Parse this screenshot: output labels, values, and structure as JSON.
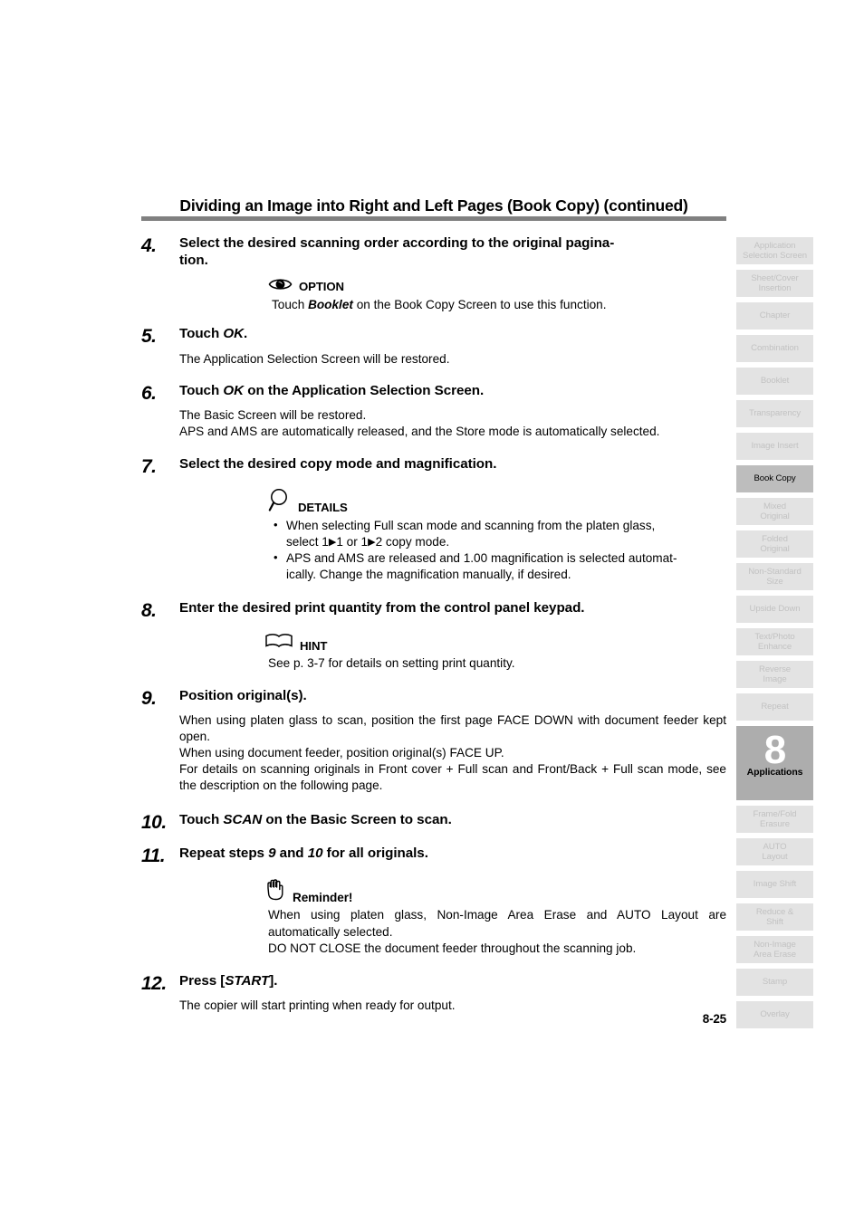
{
  "document": {
    "title": "Dividing an Image into Right and Left Pages (Book Copy) (continued)",
    "page_number": "8-25"
  },
  "steps": [
    {
      "number": "4.",
      "heading": "Select the desired scanning order according to the original pagina-tion.",
      "heading_line1": "Select the desired scanning order according to the original pagina-",
      "heading_line2": "tion."
    },
    {
      "number": "5.",
      "heading_pre": "Touch ",
      "heading_em": "OK",
      "heading_post": ".",
      "body": [
        "The Application Selection Screen will be restored."
      ]
    },
    {
      "number": "6.",
      "heading_pre": "Touch ",
      "heading_em": "OK",
      "heading_post": " on the Application Selection Screen.",
      "body": [
        "The Basic Screen will be restored.",
        "APS and AMS are automatically released, and the Store mode is automatically selected."
      ]
    },
    {
      "number": "7.",
      "heading": "Select the desired copy mode and magnification."
    },
    {
      "number": "8.",
      "heading": "Enter the desired print quantity from the control panel keypad."
    },
    {
      "number": "9.",
      "heading": "Position original(s).",
      "body": [
        "When using platen glass to scan, position the first page FACE DOWN with document feeder kept open.",
        "When using document feeder, position original(s) FACE UP.",
        "For details on scanning originals in Front cover + Full scan and Front/Back + Full scan mode, see the description on the following page."
      ]
    },
    {
      "number": "10.",
      "heading_pre": "Touch ",
      "heading_em": "SCAN",
      "heading_post": " on the Basic Screen to scan."
    },
    {
      "number": "11.",
      "heading_pre": "Repeat steps ",
      "heading_em": "9",
      "heading_mid": " and ",
      "heading_em2": "10",
      "heading_post": " for all originals."
    },
    {
      "number": "12.",
      "heading_pre": "Press [",
      "heading_em": "START",
      "heading_post": "].",
      "body": [
        "The copier will start printing when ready for output."
      ]
    }
  ],
  "callouts": {
    "option": {
      "icon": "eye-icon",
      "label": "OPTION",
      "text_pre": "Touch ",
      "text_em": "Booklet",
      "text_post": " on the Book Copy Screen to use this function."
    },
    "details": {
      "icon": "magnifier-icon",
      "label": "DETAILS",
      "bullets": [
        {
          "line1": "When selecting Full scan mode and scanning from the platen glass,",
          "line2_pre": "select 1",
          "arrow1": "▶",
          "line2_mid": "1 or 1",
          "arrow2": "▶",
          "line2_post": "2 copy mode."
        },
        {
          "line1": "APS and AMS are released and 1.00 magnification is selected automat-",
          "line2": "ically. Change the magnification manually, if desired."
        }
      ]
    },
    "hint": {
      "icon": "open-book-icon",
      "label": "HINT",
      "text": "See p. 3-7 for details on setting print quantity."
    },
    "reminder": {
      "icon": "hand-stop-icon",
      "label": "Reminder!",
      "lines": [
        "When using platen glass, Non-Image Area Erase and AUTO Layout are automatically selected.",
        "DO NOT CLOSE the document feeder throughout the scanning job."
      ]
    }
  },
  "rail": {
    "tabs": [
      {
        "label": "Application\nSelection Screen",
        "active": false
      },
      {
        "label": "Sheet/Cover\nInsertion",
        "active": false
      },
      {
        "label": "Chapter",
        "active": false
      },
      {
        "label": "Combination",
        "active": false
      },
      {
        "label": "Booklet",
        "active": false
      },
      {
        "label": "Transparency",
        "active": false
      },
      {
        "label": "Image Insert",
        "active": false
      },
      {
        "label": "Book Copy",
        "active": true
      },
      {
        "label": "Mixed\nOriginal",
        "active": false
      },
      {
        "label": "Folded\nOriginal",
        "active": false
      },
      {
        "label": "Non-Standard\nSize",
        "active": false
      },
      {
        "label": "Upside Down",
        "active": false
      },
      {
        "label": "Text/Photo\nEnhance",
        "active": false
      },
      {
        "label": "Reverse\nImage",
        "active": false
      },
      {
        "label": "Repeat",
        "active": false
      }
    ],
    "chapter_marker": {
      "number": "8",
      "name": "Applications"
    },
    "tabs_after": [
      {
        "label": "Frame/Fold\nErasure",
        "active": false
      },
      {
        "label": "AUTO\nLayout",
        "active": false
      },
      {
        "label": "Image Shift",
        "active": false
      },
      {
        "label": "Reduce &\nShift",
        "active": false
      },
      {
        "label": "Non-Image\nArea Erase",
        "active": false
      },
      {
        "label": "Stamp",
        "active": false
      },
      {
        "label": "Overlay",
        "active": false
      }
    ]
  },
  "colors": {
    "rule": "#808080",
    "tab_bg": "#e3e3e3",
    "tab_text": "#c2c2c2",
    "tab_active_bg": "#bdbdbd",
    "chapter_bg": "#adadad"
  }
}
